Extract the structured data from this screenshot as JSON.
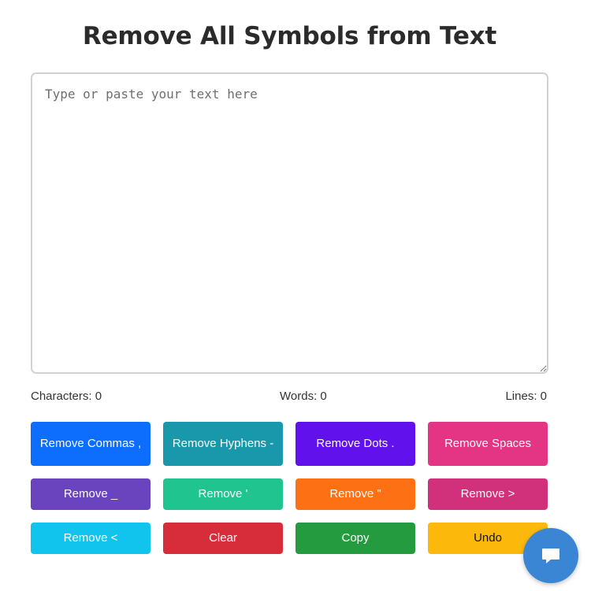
{
  "title": "Remove All Symbols from Text",
  "editor": {
    "placeholder": "Type or paste your text here",
    "value": ""
  },
  "stats": {
    "characters": "Characters: 0",
    "words": "Words: 0",
    "lines": "Lines: 0"
  },
  "buttons": [
    {
      "label": "Remove Commas ,",
      "color": "#0d6efd"
    },
    {
      "label": "Remove Hyphens -",
      "color": "#1997ab"
    },
    {
      "label": "Remove Dots .",
      "color": "#6011ec"
    },
    {
      "label": "Remove Spaces",
      "color": "#e33583"
    },
    {
      "label": "Remove _",
      "color": "#6a43be"
    },
    {
      "label": "Remove '",
      "color": "#20c48e"
    },
    {
      "label": "Remove \"",
      "color": "#fd7014"
    },
    {
      "label": "Remove >",
      "color": "#d1317a"
    },
    {
      "label": "Remove <",
      "color": "#11c4ee"
    },
    {
      "label": "Clear",
      "color": "#d72d3b"
    },
    {
      "label": "Copy",
      "color": "#259b3f"
    },
    {
      "label": "Undo",
      "color": "#fdb90b",
      "text_color": "#111111"
    }
  ],
  "chat": {
    "icon": "chat-bubble-icon",
    "color": "#3a86d4"
  }
}
